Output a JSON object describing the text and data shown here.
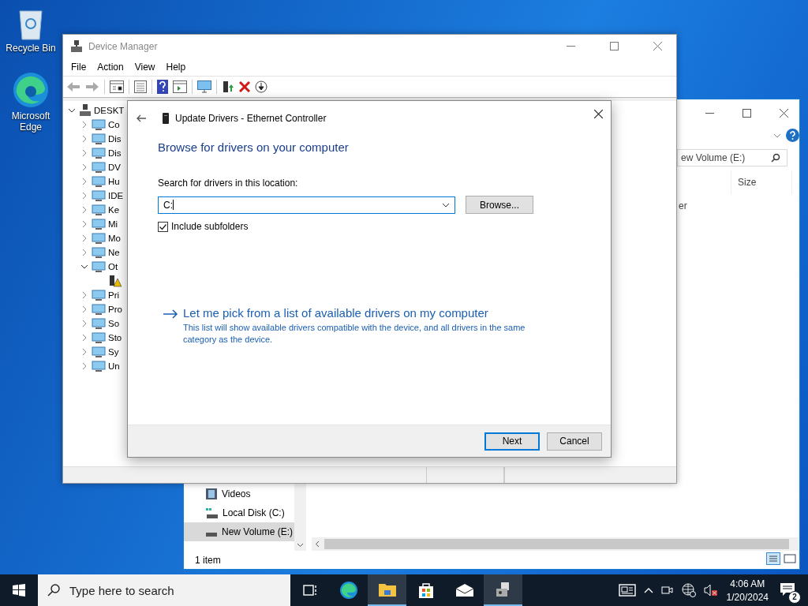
{
  "desktop": {
    "icons": [
      {
        "kind": "recycle",
        "label": "Recycle Bin"
      },
      {
        "kind": "edge",
        "label": "Microsoft Edge"
      }
    ]
  },
  "explorer": {
    "search_value": "ew Volume (E:)",
    "column_header": "Size",
    "cell_text": "er",
    "nav_items": [
      {
        "kind": "videos",
        "label": "Videos",
        "selected": false
      },
      {
        "kind": "disk_c",
        "label": "Local Disk (C:)",
        "selected": false
      },
      {
        "kind": "disk",
        "label": "New Volume (E:)",
        "selected": true
      }
    ],
    "status": "1 item"
  },
  "device_manager": {
    "title": "Device Manager",
    "menu": [
      "File",
      "Action",
      "View",
      "Help"
    ],
    "tree": {
      "label": "DESKT",
      "expanded": true,
      "children": [
        {
          "label": "Co",
          "expanded": false
        },
        {
          "label": "Dis",
          "expanded": false
        },
        {
          "label": "Dis",
          "expanded": false
        },
        {
          "label": "DV",
          "expanded": false
        },
        {
          "label": "Hu",
          "expanded": false
        },
        {
          "label": "IDE",
          "expanded": false
        },
        {
          "label": "Ke",
          "expanded": false
        },
        {
          "label": "Mi",
          "expanded": false
        },
        {
          "label": "Mo",
          "expanded": false
        },
        {
          "label": "Ne",
          "expanded": false
        },
        {
          "label": "Ot",
          "expanded": true,
          "children": [
            {
              "warning": true
            }
          ]
        },
        {
          "label": "Pri",
          "expanded": false
        },
        {
          "label": "Pro",
          "expanded": false
        },
        {
          "label": "So",
          "expanded": false
        },
        {
          "label": "Sto",
          "expanded": false
        },
        {
          "label": "Sy",
          "expanded": false
        },
        {
          "label": "Un",
          "expanded": false
        }
      ]
    }
  },
  "dialog": {
    "title": "Update Drivers - Ethernet Controller",
    "heading": "Browse for drivers on your computer",
    "field_label": "Search for drivers in this location:",
    "path_value": "C:",
    "browse_button": "Browse...",
    "include_subfolders": {
      "label": "Include subfolders",
      "checked": true
    },
    "pick_link": "Let me pick from a list of available drivers on my computer",
    "pick_description": "This list will show available drivers compatible with the device, and all drivers in the same category as the device.",
    "buttons": [
      {
        "label": "Next",
        "default": true
      },
      {
        "label": "Cancel",
        "default": false
      }
    ]
  },
  "taskbar": {
    "search_placeholder": "Type here to search",
    "apps": [
      {
        "kind": "taskview",
        "active": false
      },
      {
        "kind": "edge",
        "active": false
      },
      {
        "kind": "folder",
        "active": true
      },
      {
        "kind": "store",
        "active": false
      },
      {
        "kind": "mail",
        "active": false
      },
      {
        "kind": "devmgr",
        "active": true
      }
    ],
    "time": "4:06 AM",
    "date": "1/20/2024",
    "notifications": "2"
  }
}
